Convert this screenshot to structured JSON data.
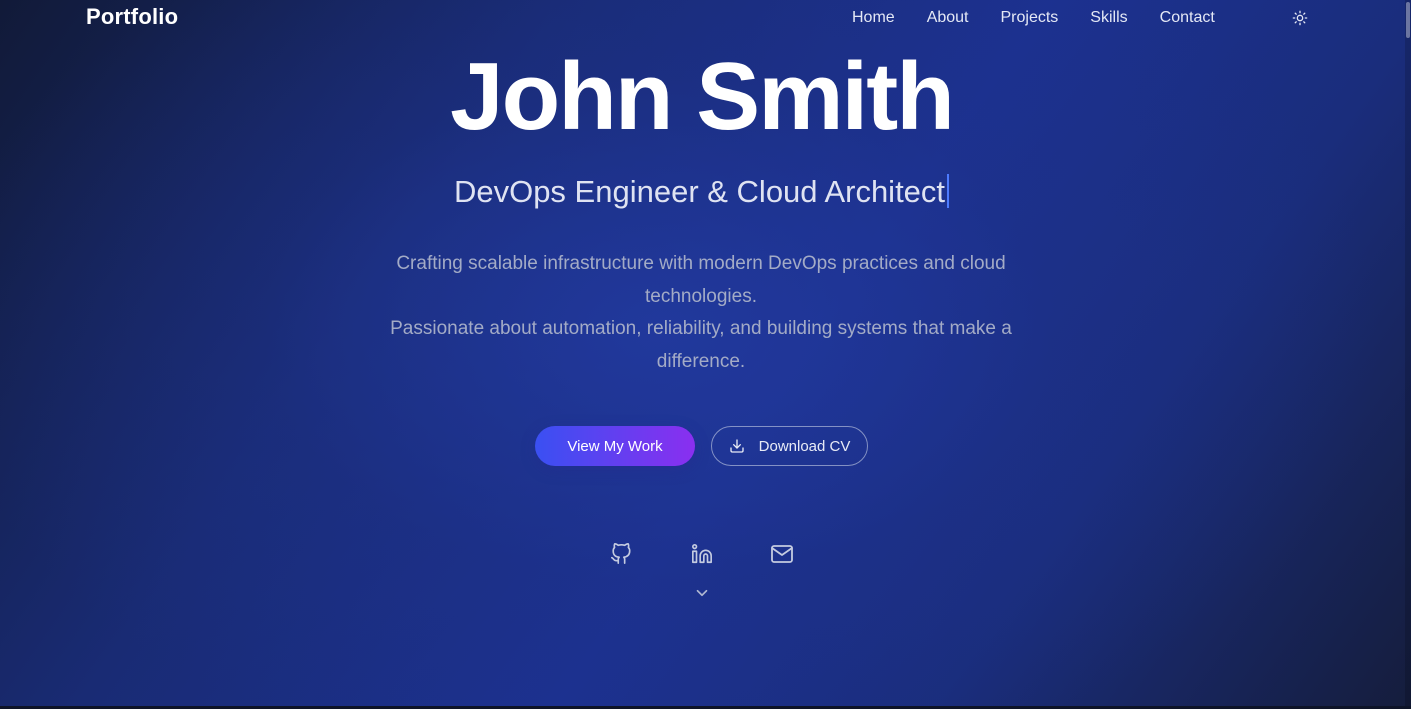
{
  "nav": {
    "brand": "Portfolio",
    "links": [
      {
        "label": "Home"
      },
      {
        "label": "About"
      },
      {
        "label": "Projects"
      },
      {
        "label": "Skills"
      },
      {
        "label": "Contact"
      }
    ],
    "theme_toggle_icon": "sun-icon"
  },
  "hero": {
    "name": "John Smith",
    "role": "DevOps Engineer & Cloud Architect",
    "description": [
      "Crafting scalable infrastructure with modern DevOps practices and cloud technologies.",
      "Passionate about automation, reliability, and building systems that make a difference."
    ],
    "primary_button": "View My Work",
    "secondary_button": "Download CV",
    "secondary_button_icon": "download-icon"
  },
  "social": [
    {
      "icon": "github-icon"
    },
    {
      "icon": "linkedin-icon"
    },
    {
      "icon": "mail-icon"
    }
  ],
  "scroll_icon": "chevron-down-icon",
  "colors": {
    "background_dark": "#111a38",
    "background_mid": "#1c3190",
    "accent_blue": "#3a50f2",
    "accent_purple": "#8a2ff0",
    "cursor": "#4d7bff",
    "muted_text": "#a3abc6"
  }
}
